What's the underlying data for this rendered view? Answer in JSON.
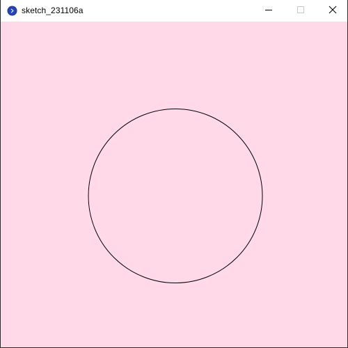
{
  "window": {
    "title": "sketch_231106a",
    "icon": "processing-app-icon",
    "controls": {
      "minimize_icon": "minimize-icon",
      "maximize_icon": "maximize-icon",
      "close_icon": "close-icon"
    }
  },
  "sketch": {
    "background_color": "#ffd9e8",
    "shape": "circle",
    "stroke_color": "#000000",
    "fill": "none"
  }
}
